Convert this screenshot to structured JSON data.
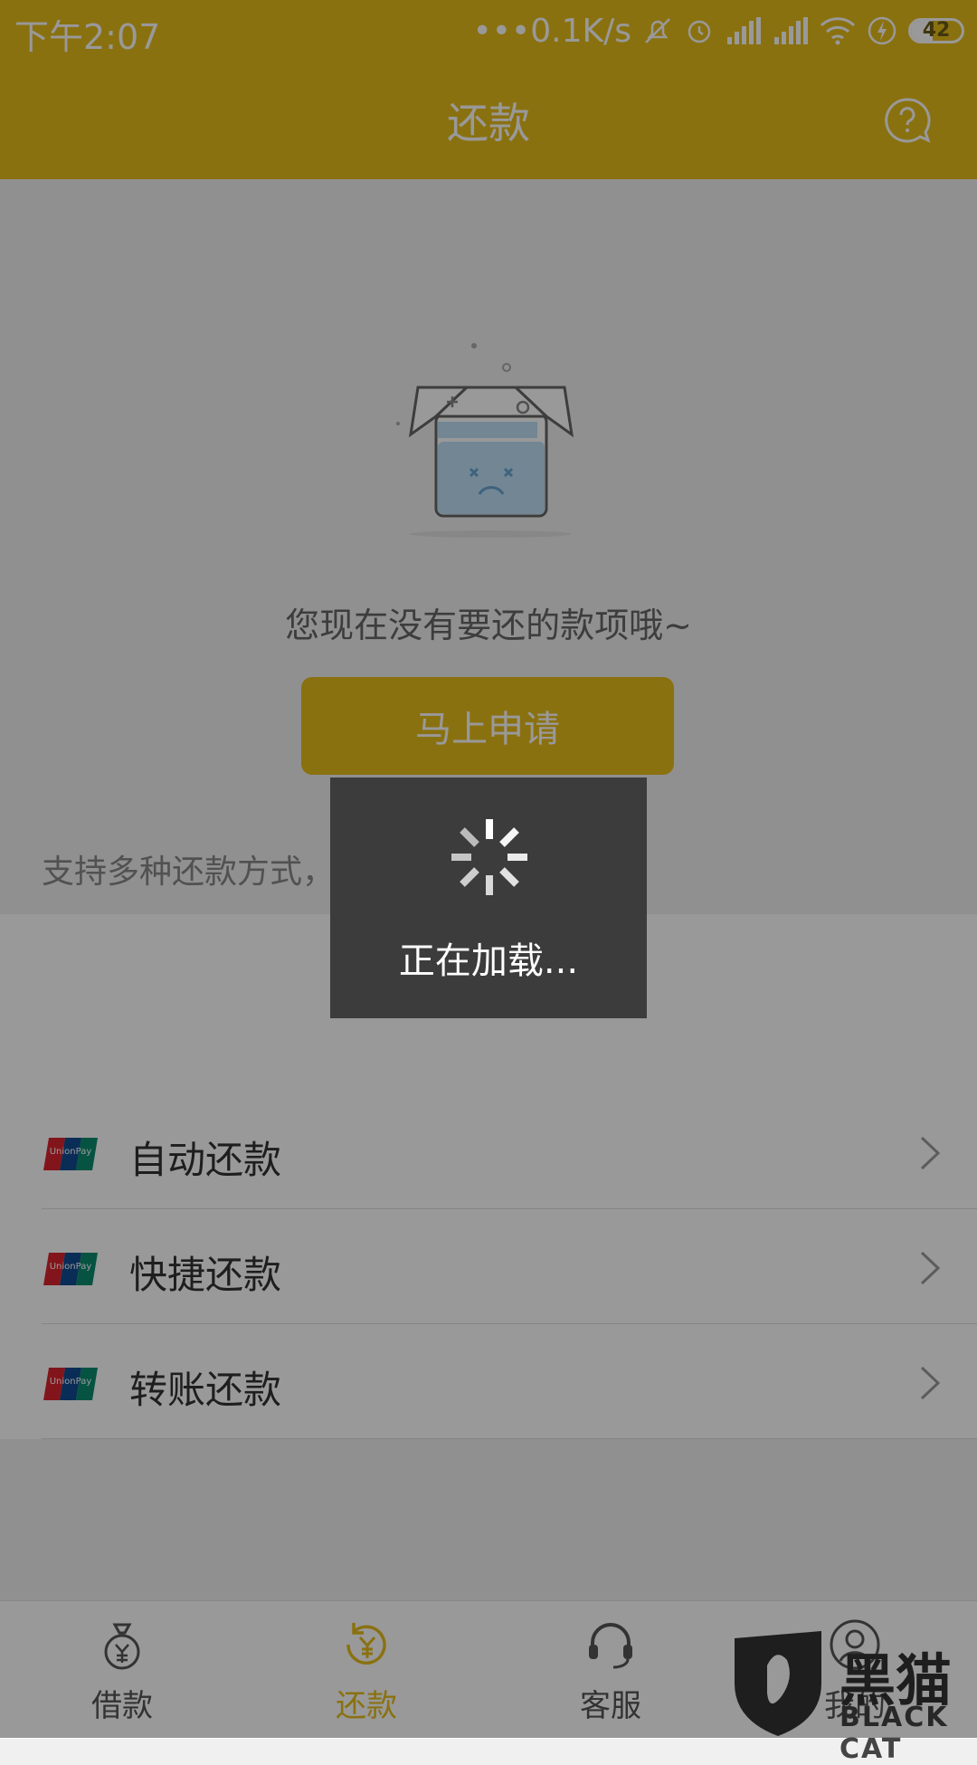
{
  "status_bar": {
    "time": "下午2:07",
    "network_speed": "•••0.1K/s",
    "battery": "42",
    "icons": [
      "mute-icon",
      "alarm-icon",
      "signal-icon",
      "signal-icon",
      "wifi-icon",
      "charging-icon"
    ]
  },
  "header": {
    "title": "还款",
    "help_icon": "help-chat-icon"
  },
  "empty_state": {
    "message": "您现在没有要还的款项哦~",
    "apply_button": "马上申请"
  },
  "repay_methods": {
    "header": "支持多种还款方式，方便快捷",
    "items": [
      {
        "label": "自动还款",
        "logo": "unionpay-logo"
      },
      {
        "label": "快捷还款",
        "logo": "unionpay-logo"
      },
      {
        "label": "转账还款",
        "logo": "unionpay-logo"
      }
    ]
  },
  "tabs": [
    {
      "label": "借款",
      "icon": "money-bag-icon",
      "active": false
    },
    {
      "label": "还款",
      "icon": "repay-icon",
      "active": true
    },
    {
      "label": "客服",
      "icon": "headset-icon",
      "active": false
    },
    {
      "label": "我的",
      "icon": "user-icon",
      "active": false
    }
  ],
  "loading": {
    "message": "正在加载..."
  },
  "watermark": {
    "title": "黑猫",
    "subtitle": "BLACK CAT"
  },
  "colors": {
    "brand": "#e6bd1c",
    "overlay": "rgba(0,0,0,0.40)",
    "toast": "#3c3c3c"
  }
}
